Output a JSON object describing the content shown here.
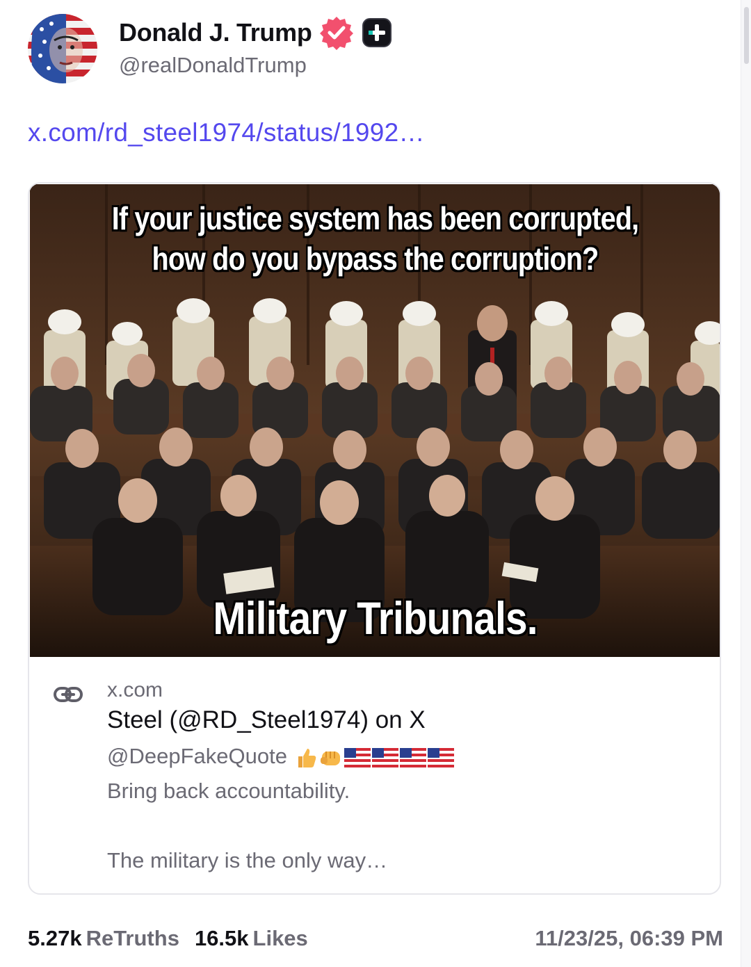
{
  "author": {
    "display_name": "Donald J. Trump",
    "handle": "@realDonaldTrump",
    "avatar_icon": "flag-portrait-avatar",
    "verified_icon": "verified-badge-icon",
    "plus_icon": "plus-badge-icon"
  },
  "post": {
    "link_text": "x.com/rd_steel1974/status/1992…"
  },
  "link_card": {
    "image": {
      "top_text_line1": "If your justice system has been corrupted,",
      "top_text_line2": "how do you bypass the corruption?",
      "bottom_text": "Military Tribunals."
    },
    "link_icon": "link-chain-icon",
    "domain": "x.com",
    "title": "Steel (@RD_Steel1974) on X",
    "desc_line1": "@DeepFakeQuote",
    "desc_emoji": [
      "thumbs-up",
      "fist",
      "us-flag",
      "us-flag",
      "us-flag",
      "us-flag"
    ],
    "desc_line2": "Bring back accountability.",
    "desc_line3": "The military is the only way…"
  },
  "stats": {
    "retruths_count": "5.27k",
    "retruths_label": "ReTruths",
    "likes_count": "16.5k",
    "likes_label": "Likes",
    "timestamp": "11/23/25, 06:39 PM"
  },
  "colors": {
    "link": "#5448ee",
    "muted": "#6b6a74",
    "verified": "#f2506e",
    "border": "#e6e6eb"
  }
}
